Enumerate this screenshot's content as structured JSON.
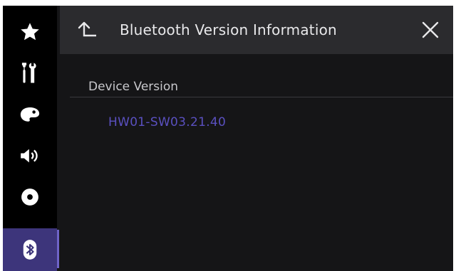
{
  "header": {
    "title": "Bluetooth Version Information",
    "back_icon": "return-arrow-icon",
    "close_icon": "close-icon"
  },
  "sidebar": {
    "items": [
      {
        "id": "favorites",
        "icon": "star-icon"
      },
      {
        "id": "settings",
        "icon": "tools-icon"
      },
      {
        "id": "theme",
        "icon": "palette-icon"
      },
      {
        "id": "audio",
        "icon": "speaker-icon"
      },
      {
        "id": "av-source",
        "icon": "disc-icon"
      },
      {
        "id": "bluetooth",
        "icon": "bluetooth-icon",
        "active": true
      }
    ]
  },
  "content": {
    "section_label": "Device Version",
    "version": "HW01-SW03.21.40"
  },
  "colors": {
    "accent": "#3d357b",
    "version_text": "#5a50c0",
    "header_bg": "#2b2b2e",
    "background": "#151517"
  }
}
